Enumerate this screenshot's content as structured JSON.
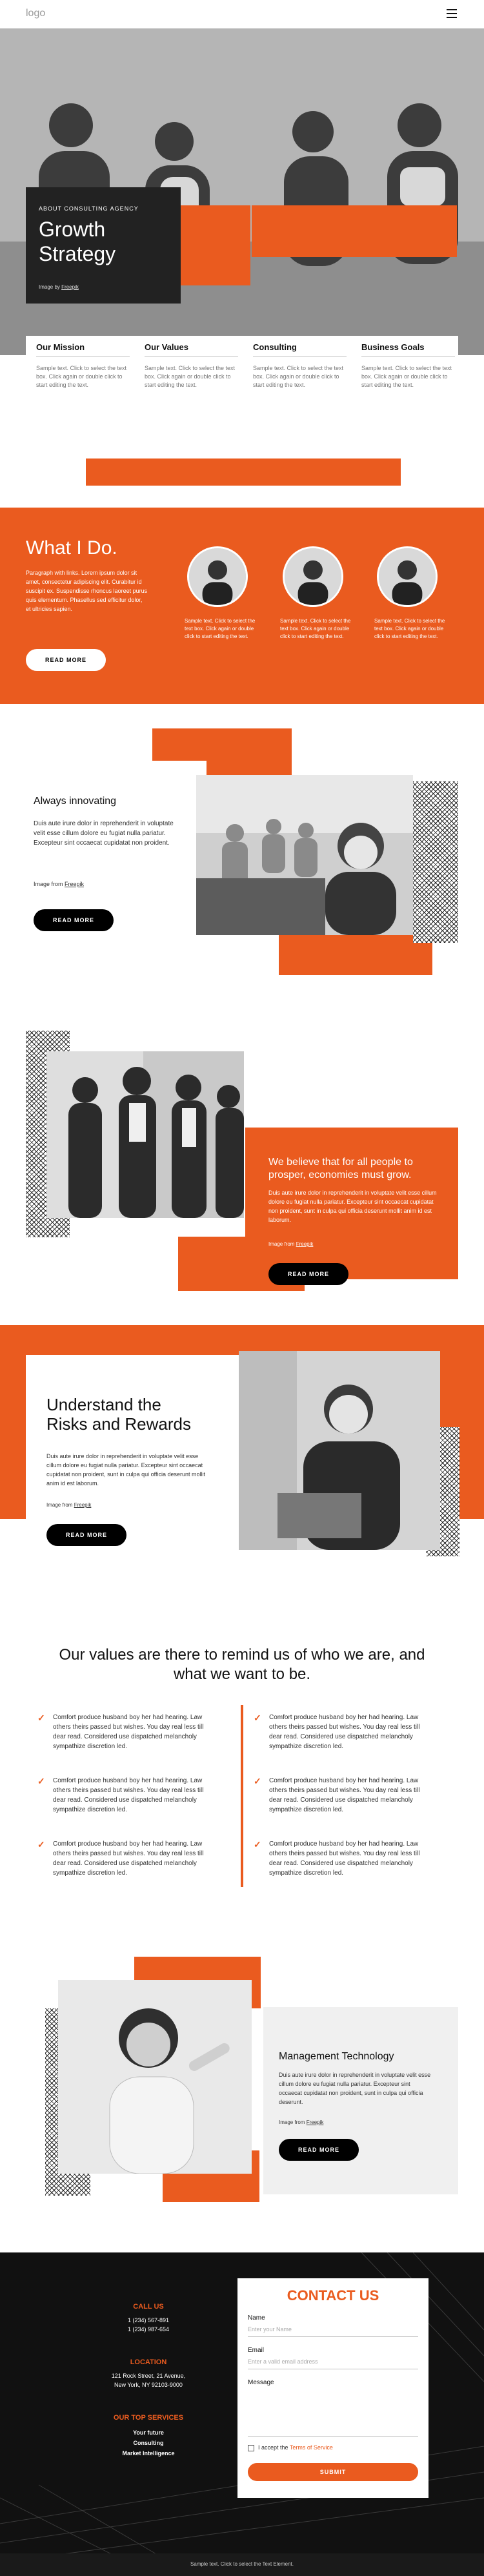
{
  "header": {
    "logo": "logo",
    "menu_icon": "hamburger-icon"
  },
  "hero": {
    "eyebrow": "ABOUT CONSULTING AGENCY",
    "title_line1": "Growth",
    "title_line2": "Strategy",
    "credit_prefix": "Image by ",
    "credit_link": "Freepik"
  },
  "features": [
    {
      "title": "Our Mission",
      "text": "Sample text. Click to select the text box. Click again or double click to start editing the text."
    },
    {
      "title": "Our Values",
      "text": "Sample text. Click to select the text box. Click again or double click to start editing the text."
    },
    {
      "title": "Consulting",
      "text": "Sample text. Click to select the text box. Click again or double click to start editing the text."
    },
    {
      "title": "Business Goals",
      "text": "Sample text. Click to select the text box. Click again or double click to start editing the text."
    }
  ],
  "whatido": {
    "title": "What I Do.",
    "text": "Paragraph with links. Lorem ipsum dolor sit amet, consectetur adipiscing elit. Curabitur id suscipit ex. Suspendisse rhoncus laoreet purus quis elementum. Phasellus sed efficitur dolor, et ultricies sapien.",
    "button": "READ MORE",
    "people": [
      {
        "text": "Sample text. Click to select the text box. Click again or double click to start editing the text."
      },
      {
        "text": "Sample text. Click to select the text box. Click again or double click to start editing the text."
      },
      {
        "text": "Sample text. Click to select the text box. Click again or double click to start editing the text."
      }
    ]
  },
  "innovating": {
    "title": "Always innovating",
    "text": "Duis aute irure dolor in reprehenderit in voluptate velit esse cillum dolore eu fugiat nulla pariatur. Excepteur sint occaecat cupidatat non proident.",
    "credit_prefix": "Image from ",
    "credit_link": "Freepik",
    "button": "READ MORE"
  },
  "believe": {
    "title": "We believe that for all people to prosper, economies must grow.",
    "text": "Duis aute irure dolor in reprehenderit in voluptate velit esse cillum dolore eu fugiat nulla pariatur. Excepteur sint occaecat cupidatat non proident, sunt in culpa qui officia deserunt mollit anim id est laborum.",
    "credit_prefix": "Image from ",
    "credit_link": "Freepik",
    "button": "READ MORE"
  },
  "risks": {
    "title_line1": "Understand the",
    "title_line2": "Risks and Rewards",
    "text": "Duis aute irure dolor in reprehenderit in voluptate velit esse cillum dolore eu fugiat nulla pariatur. Excepteur sint occaecat cupidatat non proident, sunt in culpa qui officia deserunt mollit anim id est laborum.",
    "credit_prefix": "Image from ",
    "credit_link": "Freepik",
    "button": "READ MORE"
  },
  "values": {
    "title": "Our values are there to remind us of who we are, and what we want to be.",
    "items": [
      "Comfort produce husband boy her had hearing. Law others theirs passed but wishes. You day real less till dear read. Considered use dispatched melancholy sympathize discretion led.",
      "Comfort produce husband boy her had hearing. Law others theirs passed but wishes. You day real less till dear read. Considered use dispatched melancholy sympathize discretion led.",
      "Comfort produce husband boy her had hearing. Law others theirs passed but wishes. You day real less till dear read. Considered use dispatched melancholy sympathize discretion led.",
      "Comfort produce husband boy her had hearing. Law others theirs passed but wishes. You day real less till dear read. Considered use dispatched melancholy sympathize discretion led.",
      "Comfort produce husband boy her had hearing. Law others theirs passed but wishes. You day real less till dear read. Considered use dispatched melancholy sympathize discretion led.",
      "Comfort produce husband boy her had hearing. Law others theirs passed but wishes. You day real less till dear read. Considered use dispatched melancholy sympathize discretion led."
    ]
  },
  "management": {
    "title": "Management Technology",
    "text": "Duis aute irure dolor in reprehenderit in voluptate velit esse cillum dolore eu fugiat nulla pariatur. Excepteur sint occaecat cupidatat non proident, sunt in culpa qui officia deserunt.",
    "credit_prefix": "Image from ",
    "credit_link": "Freepik",
    "button": "READ MORE"
  },
  "footer": {
    "call_us_title": "CALL US",
    "phone1": "1 (234) 567-891",
    "phone2": "1 (234) 987-654",
    "location_title": "LOCATION",
    "address1": "121 Rock Street, 21 Avenue,",
    "address2": "New York, NY 92103-9000",
    "services_title": "OUR TOP SERVICES",
    "services": [
      "Your future",
      "Consulting",
      "Market Intelligence"
    ],
    "contact_title": "CONTACT US",
    "name_label": "Name",
    "name_placeholder": "Enter your Name",
    "email_label": "Email",
    "email_placeholder": "Enter a valid email address",
    "message_label": "Message",
    "accept_label": "I accept the ",
    "terms_link": "Terms of Service",
    "submit": "SUBMIT",
    "bottom_note": "Sample text. Click to select the Text Element."
  },
  "colors": {
    "accent": "#ea5b1f",
    "dark": "#111111"
  }
}
